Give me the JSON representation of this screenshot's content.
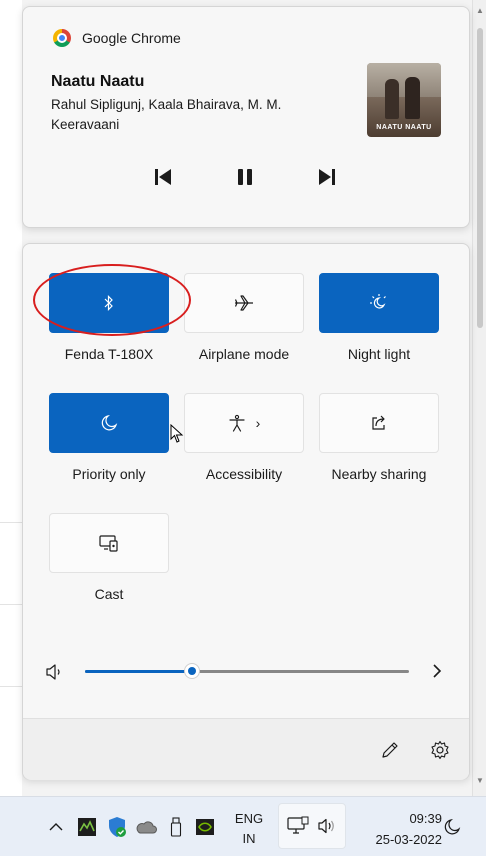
{
  "media": {
    "app_name": "Google Chrome",
    "title": "Naatu Naatu",
    "artist": "Rahul Sipligunj, Kaala Bhairava, M. M. Keeravaani",
    "album_caption": "NAATU NAATU",
    "controls": [
      "previous-icon",
      "pause-icon",
      "next-icon"
    ]
  },
  "quick_settings": {
    "tiles": [
      {
        "label": "Fenda T-180X",
        "icon": "bluetooth-icon",
        "on": true
      },
      {
        "label": "Airplane mode",
        "icon": "airplane-icon",
        "on": false
      },
      {
        "label": "Night light",
        "icon": "night-light-icon",
        "on": true
      },
      {
        "label": "Priority only",
        "icon": "moon-icon",
        "on": true
      },
      {
        "label": "Accessibility",
        "icon": "accessibility-icon",
        "on": false
      },
      {
        "label": "Nearby sharing",
        "icon": "share-icon",
        "on": false
      },
      {
        "label": "Cast",
        "icon": "cast-icon",
        "on": false
      }
    ],
    "volume_level": 0.33,
    "accent": "#0a64bf"
  },
  "taskbar": {
    "lang_line1": "ENG",
    "lang_line2": "IN",
    "time": "09:39",
    "date": "25-03-2022"
  }
}
